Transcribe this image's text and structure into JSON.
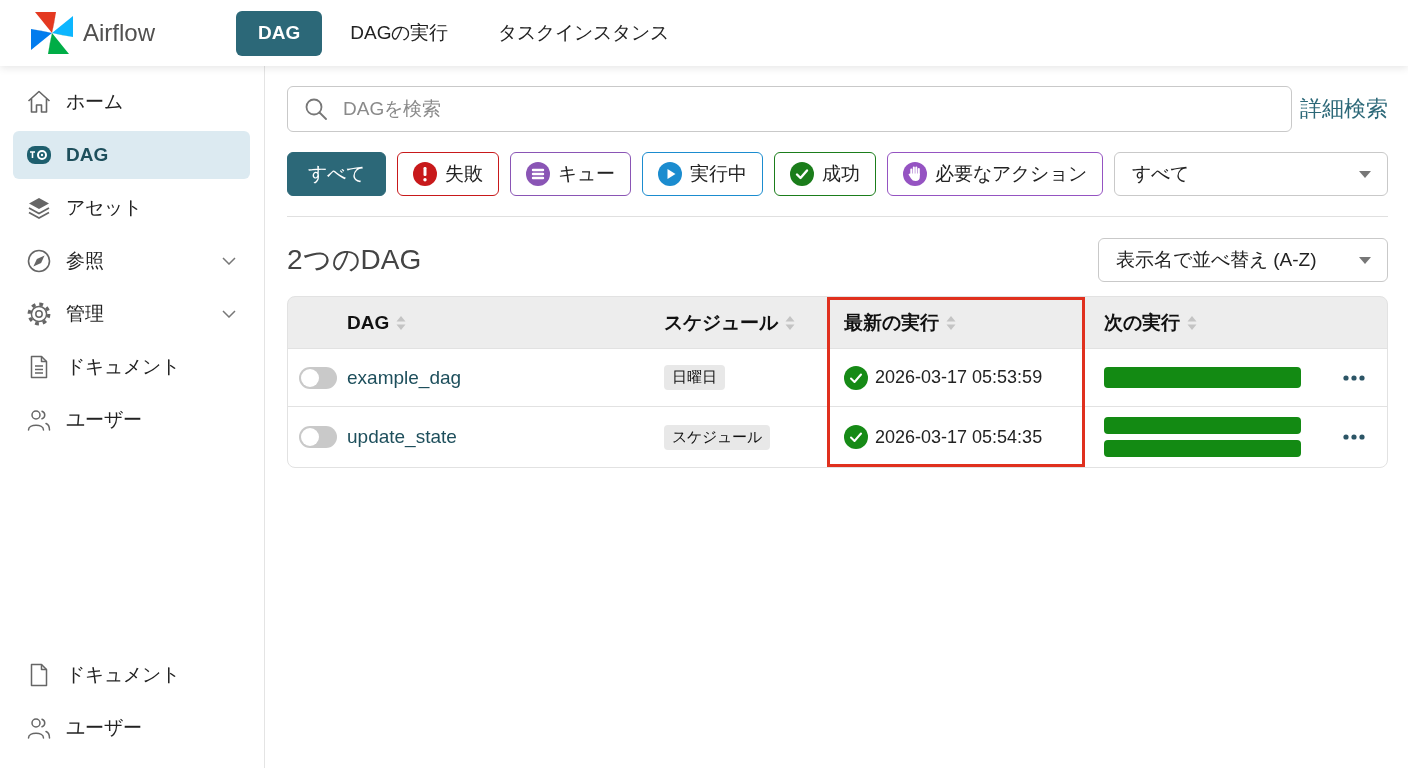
{
  "app": {
    "name": "Airflow"
  },
  "nav_tabs": [
    {
      "label": "DAG",
      "selected": true
    },
    {
      "label": "DAGの実行",
      "selected": false
    },
    {
      "label": "タスクインスタンス",
      "selected": false
    }
  ],
  "sidebar": {
    "items": [
      {
        "kind": "home",
        "label": "ホーム",
        "selected": false,
        "submenu": false
      },
      {
        "kind": "dag",
        "label": "DAG",
        "selected": true,
        "submenu": false
      },
      {
        "kind": "assets",
        "label": "アセット",
        "selected": false,
        "submenu": false
      },
      {
        "kind": "browse",
        "label": "参照",
        "selected": false,
        "submenu": true
      },
      {
        "kind": "admin",
        "label": "管理",
        "selected": false,
        "submenu": true
      },
      {
        "kind": "docs",
        "label": "ドキュメント",
        "selected": false,
        "submenu": false
      },
      {
        "kind": "users",
        "label": "ユーザー",
        "selected": false,
        "submenu": false
      }
    ],
    "footer_items": [
      {
        "kind": "page",
        "label": "ドキュメント",
        "selected": false
      },
      {
        "kind": "users",
        "label": "ユーザー",
        "selected": false
      }
    ]
  },
  "search": {
    "placeholder": "DAGを検索",
    "advanced_link": "詳細検索"
  },
  "filters": [
    {
      "kind": "all",
      "label": "すべて",
      "selected": true,
      "color": "#2c6878"
    },
    {
      "kind": "failed",
      "label": "失敗",
      "selected": false,
      "color": "#c8191b"
    },
    {
      "kind": "queued",
      "label": "キュー",
      "selected": false,
      "color": "#8a55b5"
    },
    {
      "kind": "running",
      "label": "実行中",
      "selected": false,
      "color": "#1b8ccf"
    },
    {
      "kind": "success",
      "label": "成功",
      "selected": false,
      "color": "#1b7d1b"
    },
    {
      "kind": "needs_action",
      "label": "必要なアクション",
      "selected": false,
      "color": "#9553c2"
    }
  ],
  "filter_dropdown": {
    "value": "すべて"
  },
  "heading": "2つのDAG",
  "sort": {
    "value": "表示名で並べ替え (A-Z)"
  },
  "table": {
    "columns": [
      {
        "label": "DAG",
        "sortable": true,
        "highlighted": false
      },
      {
        "label": "スケジュール",
        "sortable": true,
        "highlighted": false
      },
      {
        "label": "最新の実行",
        "sortable": true,
        "highlighted": true
      },
      {
        "label": "次の実行",
        "sortable": true,
        "highlighted": false
      }
    ],
    "rows": [
      {
        "enabled": false,
        "name": "example_dag",
        "schedule": "日曜日",
        "last_run": {
          "kind": "success",
          "time": "2026-03-17 05:53:59"
        },
        "next_run": [
          {
            "color": "#138a13"
          }
        ]
      },
      {
        "enabled": false,
        "name": "update_state",
        "schedule": "スケジュール",
        "last_run": {
          "kind": "success",
          "time": "2026-03-17 05:54:35"
        },
        "next_run": [
          {
            "color": "#138a13"
          },
          {
            "color": "#138a13"
          }
        ]
      }
    ]
  }
}
